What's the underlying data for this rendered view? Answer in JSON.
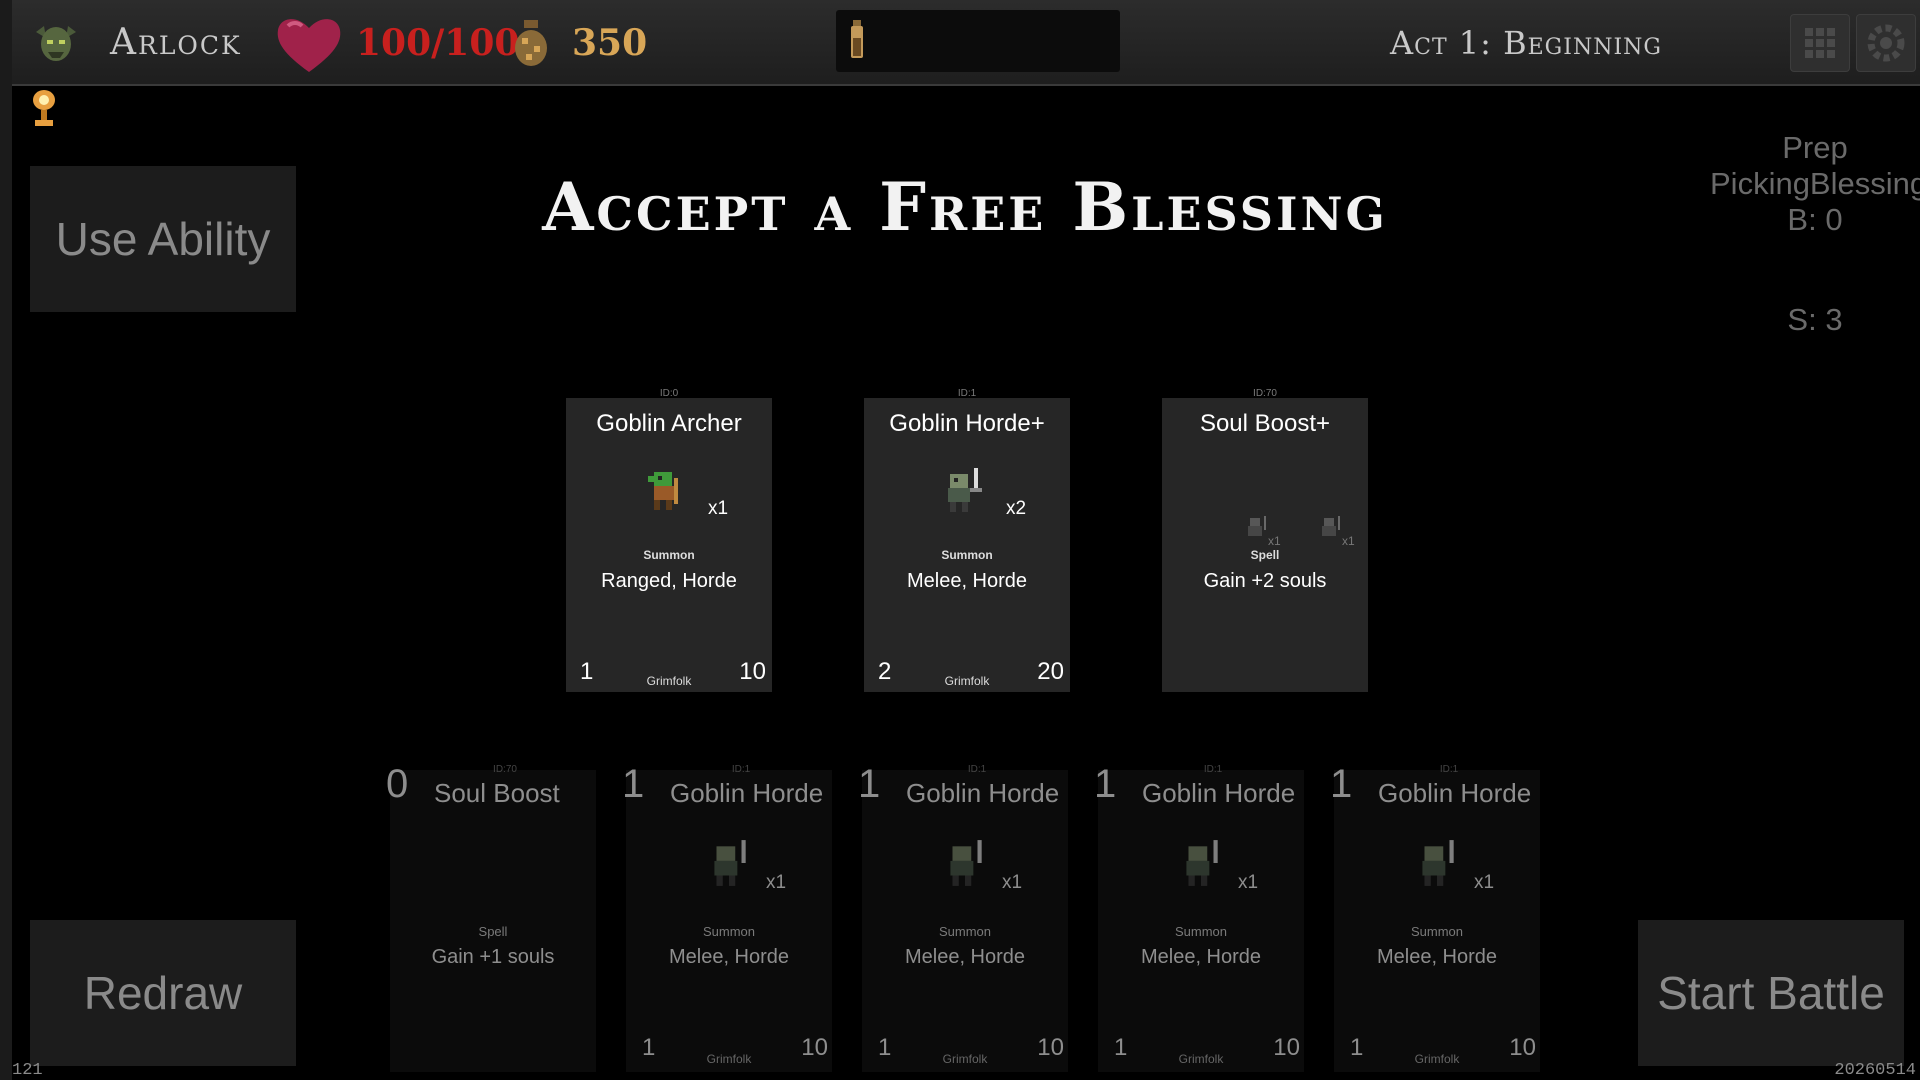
{
  "topbar": {
    "hero_name": "Arlock",
    "hp": "100/100",
    "gold": "350",
    "act_title": "Act 1: Beginning",
    "icons": [
      "goblin-head-icon",
      "heart-icon",
      "gold-pouch-icon",
      "potion-icon",
      "grid-menu-icon",
      "settings-gear-icon"
    ]
  },
  "heading": "Accept a Free Blessing",
  "buttons": {
    "use_ability": "Use Ability",
    "redraw": "Redraw",
    "start_battle": "Start Battle"
  },
  "status": {
    "phase": "Prep",
    "sub_phase": "PickingBlessing",
    "b": "B: 0",
    "s": "S: 3"
  },
  "offers": [
    {
      "id": "ID:0",
      "name": "Goblin Archer",
      "mult": "x1",
      "type": "Summon",
      "tags": "Ranged, Horde",
      "cost": "1",
      "power": "10",
      "faction": "Grimfolk"
    },
    {
      "id": "ID:1",
      "name": "Goblin Horde+",
      "mult": "x2",
      "type": "Summon",
      "tags": "Melee, Horde",
      "cost": "2",
      "power": "20",
      "faction": "Grimfolk"
    },
    {
      "id": "ID:70",
      "name": "Soul Boost+",
      "mult_a": "x1",
      "mult_b": "x1",
      "type": "Spell",
      "tags": "Gain +2 souls"
    }
  ],
  "deck": [
    {
      "count": "0",
      "id": "ID:70",
      "name": "Soul Boost",
      "type": "Spell",
      "tags": "Gain +1 souls"
    },
    {
      "count": "1",
      "id": "ID:1",
      "name": "Goblin Horde",
      "mult": "x1",
      "type": "Summon",
      "tags": "Melee, Horde",
      "cost": "1",
      "power": "10",
      "faction": "Grimfolk"
    },
    {
      "count": "1",
      "id": "ID:1",
      "name": "Goblin Horde",
      "mult": "x1",
      "type": "Summon",
      "tags": "Melee, Horde",
      "cost": "1",
      "power": "10",
      "faction": "Grimfolk"
    },
    {
      "count": "1",
      "id": "ID:1",
      "name": "Goblin Horde",
      "mult": "x1",
      "type": "Summon",
      "tags": "Melee, Horde",
      "cost": "1",
      "power": "10",
      "faction": "Grimfolk"
    },
    {
      "count": "1",
      "id": "ID:1",
      "name": "Goblin Horde",
      "mult": "x1",
      "type": "Summon",
      "tags": "Melee, Horde",
      "cost": "1",
      "power": "10",
      "faction": "Grimfolk"
    }
  ],
  "corner": {
    "left": "121",
    "right": "20260514"
  }
}
